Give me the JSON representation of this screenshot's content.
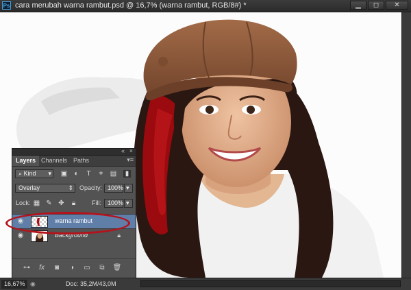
{
  "window": {
    "title": "cara merubah warna rambut.psd @ 16,7% (warna rambut, RGB/8#) *",
    "app_icon": "Ps",
    "buttons": {
      "minimize": "▁",
      "restore": "◻",
      "close": "✕"
    }
  },
  "canvas": {
    "description_icon": "photo-canvas"
  },
  "status": {
    "zoom": "16,67%",
    "doc_info": "Doc: 35,2M/43,0M"
  },
  "layers_panel": {
    "tabs": [
      {
        "label": "Layers"
      },
      {
        "label": "Channels"
      },
      {
        "label": "Paths"
      }
    ],
    "filter_kind": "Kind",
    "blend_mode": "Overlay",
    "opacity_label": "Opacity:",
    "opacity_value": "100%",
    "lock_label": "Lock:",
    "fill_label": "Fill:",
    "fill_value": "100%",
    "layers": [
      {
        "name": "warna rambut"
      },
      {
        "name": "Background"
      }
    ]
  },
  "colors": {
    "selection": "#5f7ea8",
    "highlight_ring": "#b5121b",
    "hat": "#8c5a3c",
    "hair": "#2a1712",
    "hair_red": "#9b0a0e",
    "skin": "#e2b08e"
  }
}
